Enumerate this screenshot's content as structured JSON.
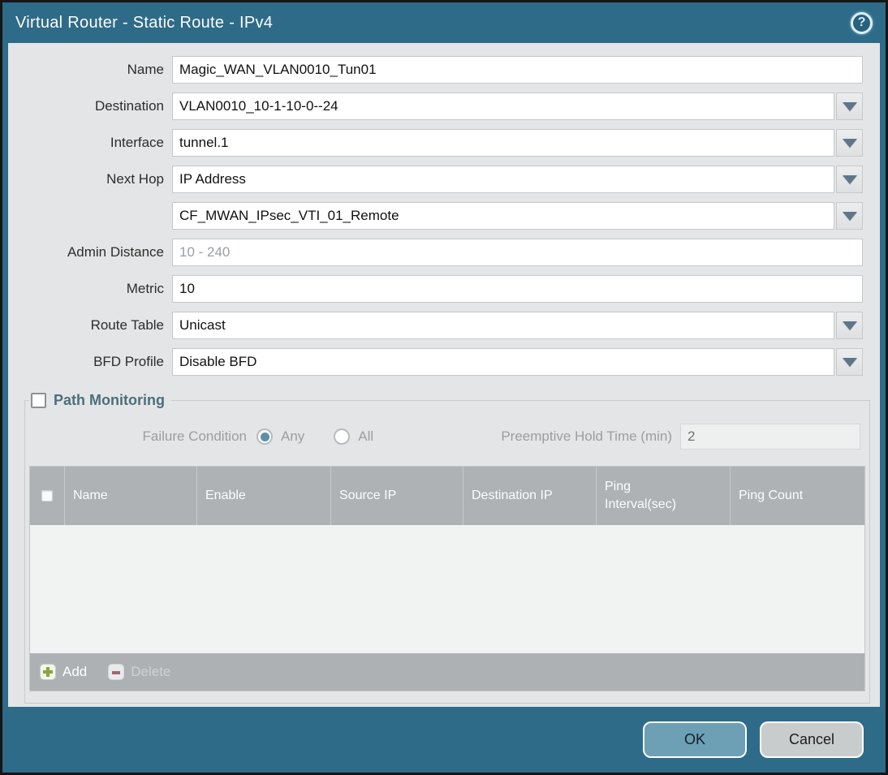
{
  "dialog": {
    "title": "Virtual Router - Static Route - IPv4",
    "help_glyph": "?"
  },
  "form": {
    "name": {
      "label": "Name",
      "value": "Magic_WAN_VLAN0010_Tun01"
    },
    "destination": {
      "label": "Destination",
      "value": "VLAN0010_10-1-10-0--24"
    },
    "interface": {
      "label": "Interface",
      "value": "tunnel.1"
    },
    "next_hop": {
      "label": "Next Hop",
      "value": "IP Address"
    },
    "next_hop_address": {
      "value": "CF_MWAN_IPsec_VTI_01_Remote"
    },
    "admin_distance": {
      "label": "Admin Distance",
      "placeholder": "10 - 240"
    },
    "metric": {
      "label": "Metric",
      "value": "10"
    },
    "route_table": {
      "label": "Route Table",
      "value": "Unicast"
    },
    "bfd_profile": {
      "label": "BFD Profile",
      "value": "Disable BFD"
    }
  },
  "path_monitoring": {
    "legend": "Path Monitoring",
    "checkbox_checked": false,
    "failure_condition_label": "Failure Condition",
    "radio_any_label": "Any",
    "radio_all_label": "All",
    "radio_selected": "Any",
    "preemptive_label": "Preemptive Hold Time (min)",
    "preemptive_value": "2",
    "table": {
      "columns": [
        "Name",
        "Enable",
        "Source IP",
        "Destination IP",
        "Ping Interval(sec)",
        "Ping Count"
      ],
      "rows": []
    },
    "add_label": "Add",
    "delete_label": "Delete"
  },
  "footer": {
    "ok_label": "OK",
    "cancel_label": "Cancel"
  },
  "colors": {
    "titlebar": "#2e6b88",
    "panel_bg": "#e4e5e6",
    "table_header_bg": "#aeb2b5",
    "ok_button_bg": "#6d9fb5",
    "cancel_button_bg": "#c9cccd",
    "add_icon_green": "#8ea33d",
    "delete_icon_red": "#a2666b",
    "legend_text": "#4a6f7d",
    "dropdown_arrow": "#5f7689"
  }
}
